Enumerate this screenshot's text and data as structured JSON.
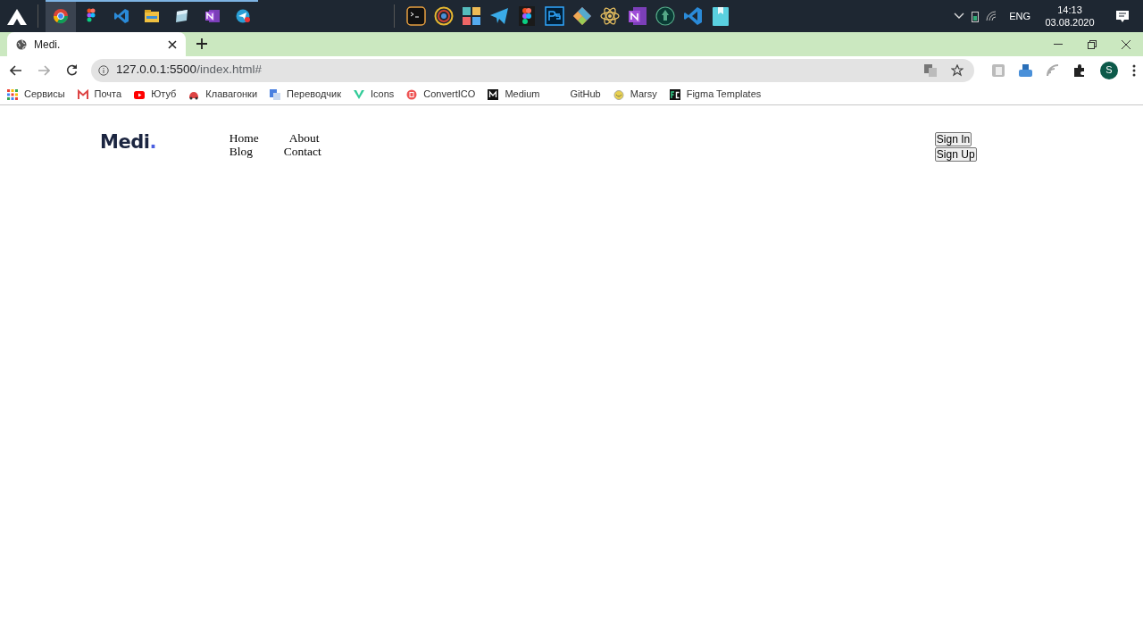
{
  "taskbar": {
    "running_apps": [
      {
        "selected": true
      },
      {
        "selected": false
      },
      {
        "selected": false
      },
      {
        "selected": false
      },
      {
        "selected": false
      },
      {
        "selected": false
      },
      {
        "selected": false
      }
    ],
    "language": "ENG",
    "time": "14:13",
    "date": "03.08.2020"
  },
  "browser": {
    "tabs": [
      {
        "title": "Medi.",
        "selected": true
      }
    ],
    "url": {
      "host": "127.0.0.1:5500",
      "path": "/index.html#"
    },
    "profile_initial": "S",
    "bookmarks": [
      "Сервисы",
      "Почта",
      "Ютуб",
      "Клавагонки",
      "Переводчик",
      "Icons",
      "ConvertICO",
      "Medium",
      "GitHub",
      "Marsy",
      "Figma Templates"
    ]
  },
  "page": {
    "logo": {
      "text": "Medi",
      "dot": "."
    },
    "nav_links": [
      "Home",
      "About",
      "Blog",
      "Contact"
    ],
    "buttons": [
      "Sign In",
      "Sign Up"
    ]
  }
}
